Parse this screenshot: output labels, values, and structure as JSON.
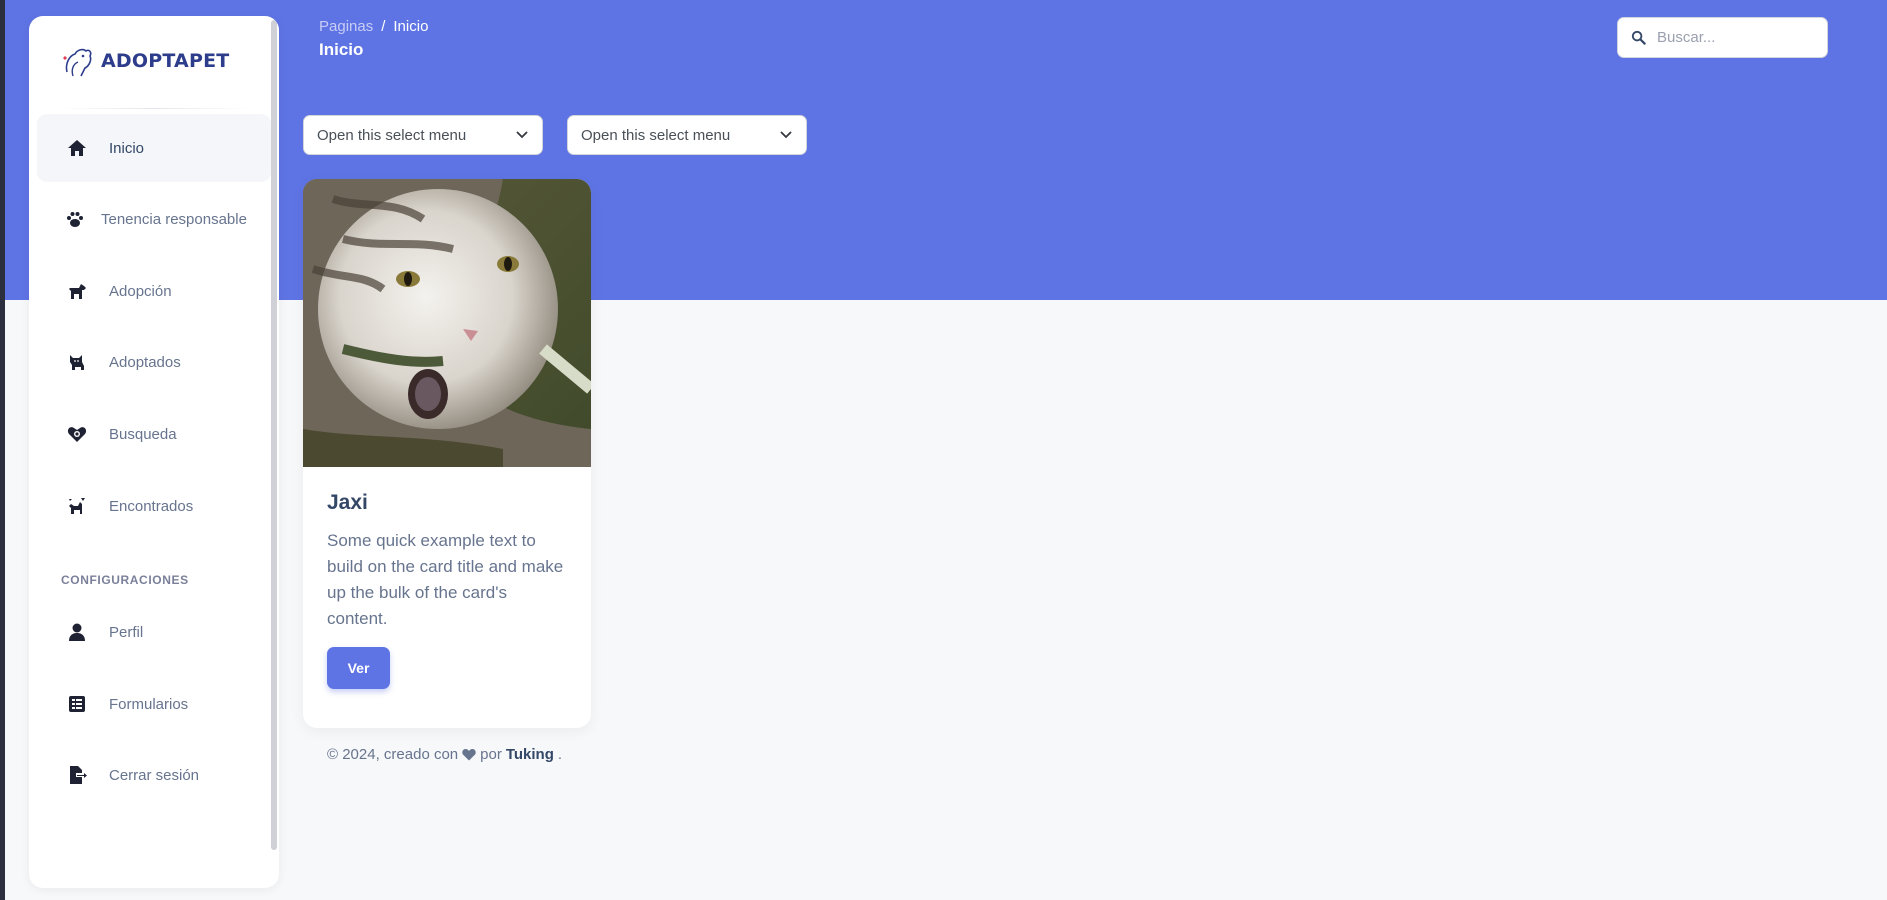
{
  "brand": {
    "name": "ADOPTAPET"
  },
  "sidebar": {
    "items": [
      {
        "label": "Inicio",
        "icon": "home-icon",
        "active": true
      },
      {
        "label": "Tenencia responsable",
        "icon": "paw-icon",
        "active": false
      },
      {
        "label": "Adopción",
        "icon": "dog-icon",
        "active": false
      },
      {
        "label": "Adoptados",
        "icon": "cat-icon",
        "active": false
      },
      {
        "label": "Busqueda",
        "icon": "search-heart-icon",
        "active": false
      },
      {
        "label": "Encontrados",
        "icon": "found-pets-icon",
        "active": false
      }
    ],
    "section_title": "CONFIGURACIONES",
    "settings_items": [
      {
        "label": "Perfil",
        "icon": "user-icon"
      },
      {
        "label": "Formularios",
        "icon": "form-icon"
      },
      {
        "label": "Cerrar sesión",
        "icon": "logout-icon"
      }
    ]
  },
  "header": {
    "breadcrumb": {
      "parent": "Paginas",
      "separator": "/",
      "current": "Inicio"
    },
    "title": "Inicio",
    "search_placeholder": "Buscar..."
  },
  "filters": {
    "select_1": "Open this select menu",
    "select_2": "Open this select menu"
  },
  "card": {
    "title": "Jaxi",
    "text": "Some quick example text to build on the card title and make up the bulk of the card's content.",
    "button": "Ver"
  },
  "footer": {
    "prefix": "© 2024, creado con",
    "by": "por",
    "author": "Tuking",
    "suffix": "."
  },
  "colors": {
    "primary": "#5f74e4",
    "background": "#f7f8fa",
    "text_dark": "#344767",
    "text_muted": "#67748e"
  }
}
